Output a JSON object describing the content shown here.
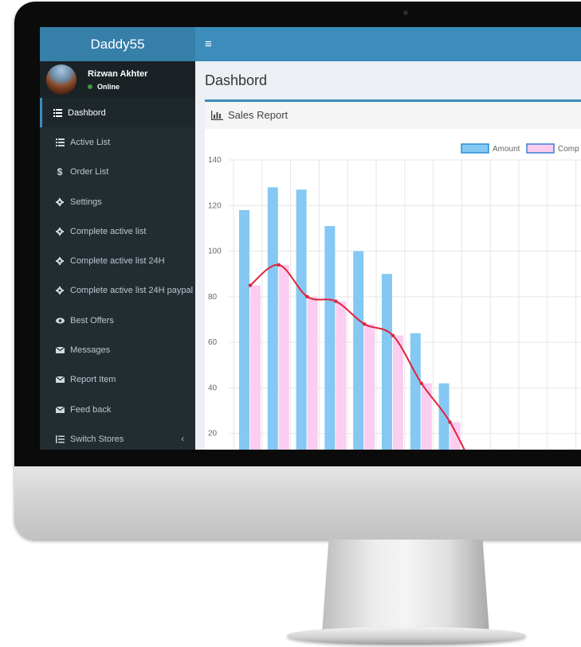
{
  "app": {
    "brand": "Daddy55"
  },
  "user": {
    "name": "Rizwan Akhter",
    "status": "Online"
  },
  "header": {
    "menu_icon": "hamburger-icon"
  },
  "sidebar": {
    "items": [
      {
        "label": "Dashbord",
        "icon": "list-icon",
        "active": true
      },
      {
        "label": "Active List",
        "icon": "list-icon"
      },
      {
        "label": "Order List",
        "icon": "dollar-icon"
      },
      {
        "label": "Settings",
        "icon": "gear-icon"
      },
      {
        "label": "Complete active list",
        "icon": "gear-icon"
      },
      {
        "label": "Complete active list 24H",
        "icon": "gear-icon"
      },
      {
        "label": "Complete active list 24H paypal",
        "icon": "gear-icon"
      },
      {
        "label": "Best Offers",
        "icon": "eye-icon"
      },
      {
        "label": "Messages",
        "icon": "envelope-icon"
      },
      {
        "label": "Report Item",
        "icon": "envelope-icon"
      },
      {
        "label": "Feed back",
        "icon": "envelope-icon"
      },
      {
        "label": "Switch Stores",
        "icon": "list-ol-icon",
        "caret": "‹"
      }
    ]
  },
  "page": {
    "title": "Dashbord"
  },
  "panel": {
    "title": "Sales Report",
    "icon": "bar-chart-icon"
  },
  "chart_data": {
    "type": "bar",
    "legend": [
      "Amount",
      "Comp"
    ],
    "legend_placement": "top-right",
    "ylim": [
      0,
      140
    ],
    "yticks": [
      140,
      120,
      100,
      80,
      60,
      40,
      20
    ],
    "grid": true,
    "series": [
      {
        "name": "Amount",
        "color": "#84c8f3",
        "values": [
          118,
          128,
          127,
          111,
          100,
          90,
          64,
          42
        ]
      },
      {
        "name": "Comp",
        "color": "#fbcdf0",
        "values": [
          85,
          94,
          80,
          78,
          68,
          63,
          42,
          25
        ]
      }
    ],
    "line": {
      "color": "#e0233a",
      "values": [
        85,
        94,
        80,
        78,
        68,
        63,
        42,
        25,
        0
      ]
    }
  }
}
